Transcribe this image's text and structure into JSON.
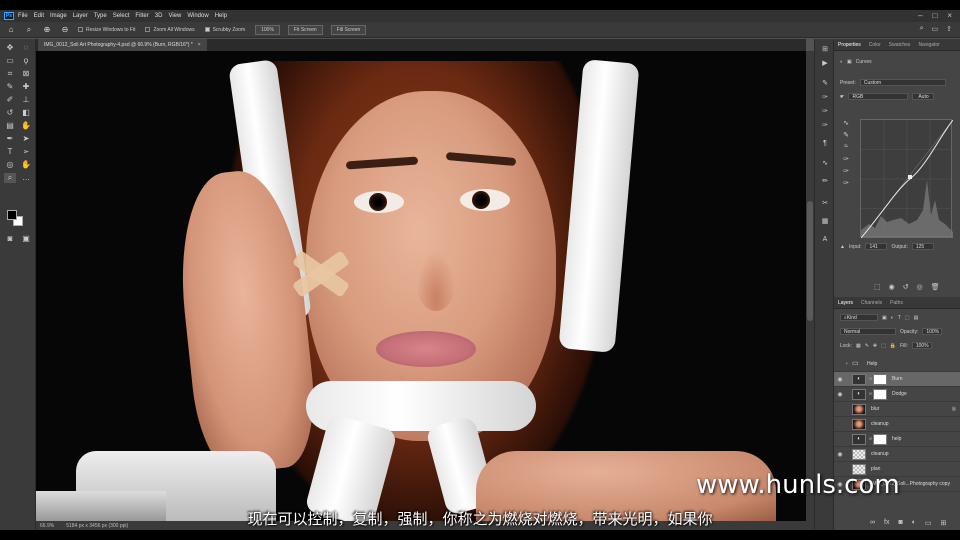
{
  "menubar": {
    "app_logo": "Ps",
    "items": [
      "File",
      "Edit",
      "Image",
      "Layer",
      "Type",
      "Select",
      "Filter",
      "3D",
      "View",
      "Window",
      "Help"
    ]
  },
  "options": {
    "resize_windows": "Resize Windows to Fit",
    "zoom_all": "Zoom All Windows",
    "scrubby_zoom": "Scrubby Zoom",
    "zoom_value": "100%",
    "fit_screen": "Fit Screen",
    "fill_screen": "Fill Screen"
  },
  "document": {
    "tab_title": "IMG_0012_Soli Art Photography-4.psd @ 66.9% (Burn, RGB/16*) *",
    "status_zoom": "66.9%",
    "status_size": "5184 px x 3456 px (300 ppi)"
  },
  "properties": {
    "tabs": [
      "Properties",
      "Color",
      "Swatches",
      "Navigator"
    ],
    "panel_name": "Curves",
    "preset_label": "Preset:",
    "preset_value": "Custom",
    "channel_value": "RGB",
    "auto_label": "Auto",
    "input_label": "Input:",
    "input_value": "141",
    "output_label": "Output:",
    "output_value": "125"
  },
  "layers": {
    "tabs": [
      "Layers",
      "Channels",
      "Paths"
    ],
    "kind_label": "Kind",
    "blend_mode": "Normal",
    "opacity_label": "Opacity:",
    "opacity_value": "100%",
    "lock_label": "Lock:",
    "fill_label": "Fill:",
    "fill_value": "100%",
    "items": [
      {
        "name": "Help",
        "type": "folder"
      },
      {
        "name": "Burn",
        "type": "curves"
      },
      {
        "name": "Dodge",
        "type": "curves"
      },
      {
        "name": "blur",
        "type": "photo"
      },
      {
        "name": "cleanup",
        "type": "photo"
      },
      {
        "name": "help",
        "type": "curves"
      },
      {
        "name": "cleanup",
        "type": "check"
      },
      {
        "name": "plan",
        "type": "check"
      },
      {
        "name": "IMG_0012_Soli...Photography copy",
        "type": "photo"
      }
    ]
  },
  "overlay": {
    "subtitle": "现在可以控制，复制，强制，你称之为燃烧对燃烧，带来光明，如果你",
    "watermark": "www.hunls.com"
  }
}
